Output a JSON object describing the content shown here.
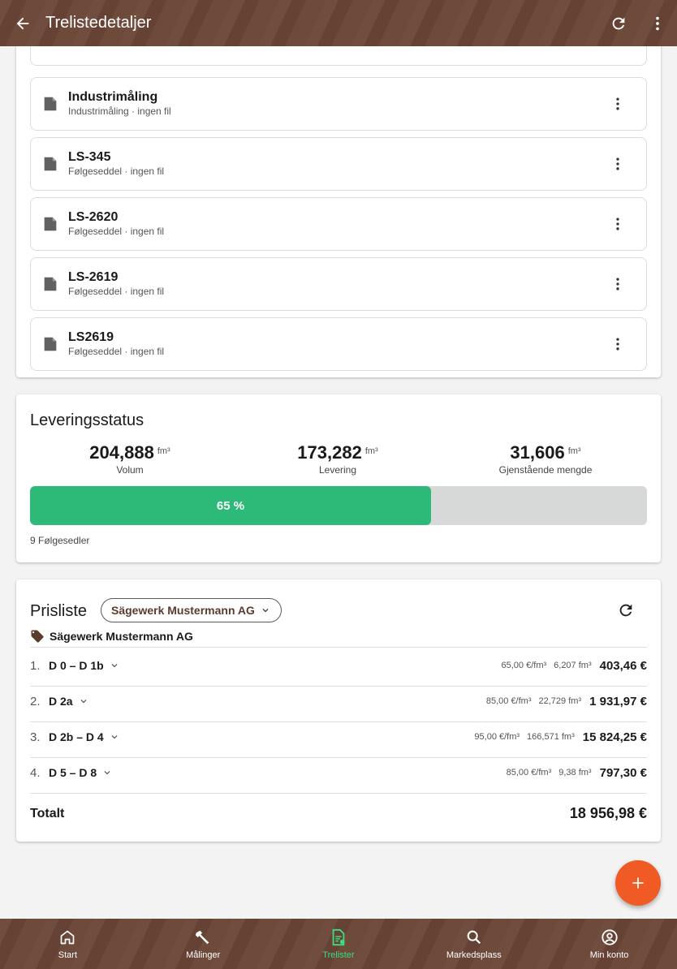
{
  "app_bar": {
    "title": "Trelistedetaljer",
    "back_icon": "arrow-back-icon",
    "refresh_icon": "refresh-icon",
    "more_icon": "more-vert-icon"
  },
  "documents": [
    {
      "name": "Industrimåling",
      "subtitle": "Industrimåling · ingen fil"
    },
    {
      "name": "LS-345",
      "subtitle": "Følgeseddel · ingen fil"
    },
    {
      "name": "LS-2620",
      "subtitle": "Følgeseddel · ingen fil"
    },
    {
      "name": "LS-2619",
      "subtitle": "Følgeseddel · ingen fil"
    },
    {
      "name": "LS2619",
      "subtitle": "Følgeseddel · ingen fil"
    }
  ],
  "delivery_status": {
    "title": "Leveringsstatus",
    "stats": [
      {
        "value": "204,888",
        "unit": "fm³",
        "label": "Volum"
      },
      {
        "value": "173,282",
        "unit": "fm³",
        "label": "Levering"
      },
      {
        "value": "31,606",
        "unit": "fm³",
        "label": "Gjenstående mengde"
      }
    ],
    "progress_percent": 65,
    "progress_label": "65 %",
    "footer": "9 Følgesedler"
  },
  "price_list": {
    "title": "Prisliste",
    "selected_supplier": "Sägewerk Mustermann AG",
    "supplier_name": "Sägewerk Mustermann AG",
    "rows": [
      {
        "index": "1.",
        "class": "D 0 – D 1b",
        "unit_price": "65,00 €/fm³",
        "volume": "6,207 fm³",
        "sum": "403,46 €"
      },
      {
        "index": "2.",
        "class": "D 2a",
        "unit_price": "85,00 €/fm³",
        "volume": "22,729 fm³",
        "sum": "1 931,97 €"
      },
      {
        "index": "3.",
        "class": "D 2b – D 4",
        "unit_price": "95,00 €/fm³",
        "volume": "166,571 fm³",
        "sum": "15 824,25 €"
      },
      {
        "index": "4.",
        "class": "D 5 – D 8",
        "unit_price": "85,00 €/fm³",
        "volume": "9,38 fm³",
        "sum": "797,30 €"
      }
    ],
    "total_label": "Totalt",
    "total_value": "18 956,98 €"
  },
  "bottom_nav": [
    {
      "label": "Start",
      "icon": "home-icon"
    },
    {
      "label": "Målinger",
      "icon": "hammer-icon"
    },
    {
      "label": "Trelister",
      "icon": "document-list-icon",
      "active": true
    },
    {
      "label": "Markedsplass",
      "icon": "search-icon"
    },
    {
      "label": "Min konto",
      "icon": "account-circle-icon"
    }
  ],
  "colors": {
    "wood_brown": "#6a4636",
    "accent_green": "#2dba78",
    "fab_orange": "#f05a24",
    "nav_active": "#3ddc84"
  }
}
